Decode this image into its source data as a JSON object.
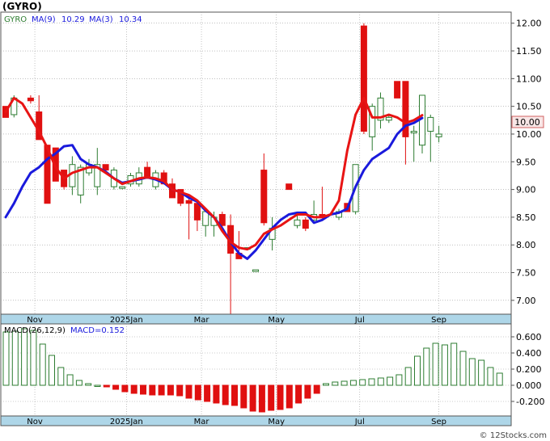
{
  "ticker": "(GYRO)",
  "legend": {
    "symbol": "GYRO",
    "ma9_label": "MA(9)",
    "ma9_value": "10.29",
    "ma3_label": "MA(3)",
    "ma3_value": "10.34"
  },
  "macd_legend": {
    "label": "MACD(26,12,9)",
    "value_label": "MACD=0.152"
  },
  "last_price_badge": "10.00",
  "watermark": "© 12Stocks.com",
  "colors": {
    "up_candle": "#2e7d32",
    "down_candle": "#e01010",
    "ma9": "#1a1adc",
    "ma3": "#e81414",
    "axis_band": "#aed6e8",
    "grid": "#9a9a9a"
  },
  "chart_data": [
    {
      "type": "candlestick",
      "title": "(GYRO)",
      "y_axis_ticks": [
        12.0,
        11.5,
        11.0,
        10.5,
        10.0,
        9.5,
        9.0,
        8.5,
        8.0,
        7.5,
        7.0
      ],
      "y_axis_labels": [
        "12.00",
        "11.50",
        "11.00",
        "10.50",
        "10.00",
        "9.50",
        "9.00",
        "8.50",
        "8.00",
        "7.50",
        "7.00"
      ],
      "ylim": [
        6.75,
        12.2
      ],
      "x_axis_labels": [
        "Nov",
        "2025Jan",
        "Mar",
        "May",
        "Jul",
        "Sep"
      ],
      "x_axis_label_weeks": [
        3.5,
        14.5,
        23.5,
        32.5,
        42.5,
        52
      ],
      "weeks": 58,
      "candles": [
        {
          "w": 0,
          "o": 10.5,
          "h": 10.5,
          "l": 10.3,
          "c": 10.3
        },
        {
          "w": 1,
          "o": 10.35,
          "h": 10.7,
          "l": 10.3,
          "c": 10.65
        },
        {
          "w": 3,
          "o": 10.65,
          "h": 10.7,
          "l": 10.55,
          "c": 10.6
        },
        {
          "w": 4,
          "o": 10.4,
          "h": 10.7,
          "l": 9.9,
          "c": 9.9
        },
        {
          "w": 5,
          "o": 9.8,
          "h": 9.8,
          "l": 8.75,
          "c": 8.75
        },
        {
          "w": 6,
          "o": 9.75,
          "h": 9.75,
          "l": 9.15,
          "c": 9.15
        },
        {
          "w": 7,
          "o": 9.35,
          "h": 9.35,
          "l": 9.0,
          "c": 9.05
        },
        {
          "w": 8,
          "o": 9.05,
          "h": 9.6,
          "l": 8.9,
          "c": 9.45
        },
        {
          "w": 9,
          "o": 8.9,
          "h": 9.45,
          "l": 8.75,
          "c": 9.4
        },
        {
          "w": 10,
          "o": 9.3,
          "h": 9.55,
          "l": 9.25,
          "c": 9.45
        },
        {
          "w": 11,
          "o": 9.05,
          "h": 9.75,
          "l": 8.9,
          "c": 9.45
        },
        {
          "w": 12,
          "o": 9.45,
          "h": 9.45,
          "l": 9.3,
          "c": 9.35
        },
        {
          "w": 13,
          "o": 9.05,
          "h": 9.4,
          "l": 9.0,
          "c": 9.35
        },
        {
          "w": 14,
          "o": 9.05,
          "h": 9.05,
          "l": 9.0,
          "c": 9.05
        },
        {
          "w": 15,
          "o": 9.1,
          "h": 9.3,
          "l": 9.05,
          "c": 9.25
        },
        {
          "w": 16,
          "o": 9.1,
          "h": 9.4,
          "l": 9.05,
          "c": 9.3
        },
        {
          "w": 17,
          "o": 9.4,
          "h": 9.5,
          "l": 9.2,
          "c": 9.2
        },
        {
          "w": 18,
          "o": 9.05,
          "h": 9.35,
          "l": 9.0,
          "c": 9.3
        },
        {
          "w": 19,
          "o": 9.3,
          "h": 9.35,
          "l": 9.1,
          "c": 9.1
        },
        {
          "w": 20,
          "o": 9.1,
          "h": 9.2,
          "l": 8.85,
          "c": 8.85
        },
        {
          "w": 21,
          "o": 9.0,
          "h": 9.0,
          "l": 8.7,
          "c": 8.75
        },
        {
          "w": 22,
          "o": 8.8,
          "h": 8.85,
          "l": 8.1,
          "c": 8.75
        },
        {
          "w": 23,
          "o": 8.75,
          "h": 8.75,
          "l": 8.25,
          "c": 8.45
        },
        {
          "w": 24,
          "o": 8.35,
          "h": 8.6,
          "l": 8.15,
          "c": 8.6
        },
        {
          "w": 25,
          "o": 8.35,
          "h": 8.6,
          "l": 8.15,
          "c": 8.5
        },
        {
          "w": 26,
          "o": 8.55,
          "h": 8.6,
          "l": 8.3,
          "c": 8.35
        },
        {
          "w": 27,
          "o": 8.35,
          "h": 8.55,
          "l": 6.75,
          "c": 7.85
        },
        {
          "w": 28,
          "o": 7.85,
          "h": 8.25,
          "l": 7.75,
          "c": 7.75
        },
        {
          "w": 29,
          "o": 7.95,
          "h": 7.95,
          "l": 7.95,
          "c": 7.95
        },
        {
          "w": 30,
          "o": 7.55,
          "h": 7.55,
          "l": 7.55,
          "c": 7.55
        },
        {
          "w": 31,
          "o": 9.35,
          "h": 9.65,
          "l": 8.35,
          "c": 8.4
        },
        {
          "w": 32,
          "o": 8.1,
          "h": 8.5,
          "l": 7.9,
          "c": 8.3
        },
        {
          "w": 34,
          "o": 9.1,
          "h": 9.1,
          "l": 9.0,
          "c": 9.0
        },
        {
          "w": 35,
          "o": 8.35,
          "h": 8.55,
          "l": 8.3,
          "c": 8.45
        },
        {
          "w": 36,
          "o": 8.45,
          "h": 8.5,
          "l": 8.25,
          "c": 8.3
        },
        {
          "w": 37,
          "o": 8.45,
          "h": 8.8,
          "l": 8.4,
          "c": 8.55
        },
        {
          "w": 38,
          "o": 8.55,
          "h": 9.05,
          "l": 8.5,
          "c": 8.5
        },
        {
          "w": 40,
          "o": 8.5,
          "h": 8.65,
          "l": 8.45,
          "c": 8.6
        },
        {
          "w": 41,
          "o": 8.75,
          "h": 8.75,
          "l": 8.6,
          "c": 8.6
        },
        {
          "w": 42,
          "o": 8.6,
          "h": 9.45,
          "l": 8.55,
          "c": 9.45
        },
        {
          "w": 43,
          "o": 11.95,
          "h": 12.0,
          "l": 10.0,
          "c": 10.05
        },
        {
          "w": 44,
          "o": 9.95,
          "h": 10.55,
          "l": 9.7,
          "c": 10.5
        },
        {
          "w": 45,
          "o": 10.25,
          "h": 10.75,
          "l": 10.1,
          "c": 10.65
        },
        {
          "w": 46,
          "o": 10.25,
          "h": 10.35,
          "l": 10.2,
          "c": 10.3
        },
        {
          "w": 47,
          "o": 10.95,
          "h": 10.95,
          "l": 10.65,
          "c": 10.65
        },
        {
          "w": 48,
          "o": 10.95,
          "h": 10.95,
          "l": 9.45,
          "c": 9.95
        },
        {
          "w": 49,
          "o": 10.05,
          "h": 10.15,
          "l": 9.5,
          "c": 10.05
        },
        {
          "w": 50,
          "o": 9.8,
          "h": 10.7,
          "l": 9.65,
          "c": 10.7
        },
        {
          "w": 51,
          "o": 10.05,
          "h": 10.35,
          "l": 9.5,
          "c": 10.3
        },
        {
          "w": 52,
          "o": 9.95,
          "h": 10.15,
          "l": 9.85,
          "c": 10.0
        }
      ],
      "series": [
        {
          "name": "MA(9)",
          "color": "#1a1adc",
          "points": [
            [
              0,
              8.5
            ],
            [
              1,
              8.75
            ],
            [
              2,
              9.05
            ],
            [
              3,
              9.3
            ],
            [
              4,
              9.4
            ],
            [
              5,
              9.55
            ],
            [
              6,
              9.65
            ],
            [
              7,
              9.78
            ],
            [
              8,
              9.8
            ],
            [
              9,
              9.55
            ],
            [
              10,
              9.45
            ],
            [
              11,
              9.4
            ],
            [
              12,
              9.32
            ],
            [
              13,
              9.2
            ],
            [
              14,
              9.12
            ],
            [
              15,
              9.15
            ],
            [
              16,
              9.18
            ],
            [
              17,
              9.22
            ],
            [
              18,
              9.18
            ],
            [
              19,
              9.12
            ],
            [
              20,
              9.0
            ],
            [
              21,
              8.95
            ],
            [
              22,
              8.85
            ],
            [
              23,
              8.78
            ],
            [
              24,
              8.62
            ],
            [
              25,
              8.5
            ],
            [
              26,
              8.3
            ],
            [
              27,
              8.05
            ],
            [
              28,
              7.85
            ],
            [
              29,
              7.75
            ],
            [
              30,
              7.9
            ],
            [
              31,
              8.1
            ],
            [
              32,
              8.3
            ],
            [
              33,
              8.45
            ],
            [
              34,
              8.55
            ],
            [
              35,
              8.58
            ],
            [
              36,
              8.58
            ],
            [
              37,
              8.4
            ],
            [
              38,
              8.45
            ],
            [
              39,
              8.55
            ],
            [
              40,
              8.58
            ],
            [
              41,
              8.65
            ],
            [
              42,
              9.05
            ],
            [
              43,
              9.35
            ],
            [
              44,
              9.55
            ],
            [
              45,
              9.65
            ],
            [
              46,
              9.75
            ],
            [
              47,
              10.0
            ],
            [
              48,
              10.15
            ],
            [
              49,
              10.2
            ],
            [
              50,
              10.29
            ]
          ]
        },
        {
          "name": "MA(3)",
          "color": "#e81414",
          "points": [
            [
              0,
              10.4
            ],
            [
              1,
              10.65
            ],
            [
              2,
              10.55
            ],
            [
              3,
              10.3
            ],
            [
              4,
              10.05
            ],
            [
              5,
              9.75
            ],
            [
              6,
              9.4
            ],
            [
              7,
              9.2
            ],
            [
              8,
              9.3
            ],
            [
              9,
              9.35
            ],
            [
              10,
              9.4
            ],
            [
              11,
              9.4
            ],
            [
              12,
              9.3
            ],
            [
              13,
              9.2
            ],
            [
              14,
              9.1
            ],
            [
              15,
              9.15
            ],
            [
              16,
              9.2
            ],
            [
              17,
              9.22
            ],
            [
              18,
              9.2
            ],
            [
              19,
              9.15
            ],
            [
              20,
              9.0
            ],
            [
              21,
              8.95
            ],
            [
              22,
              8.9
            ],
            [
              23,
              8.8
            ],
            [
              24,
              8.65
            ],
            [
              25,
              8.5
            ],
            [
              26,
              8.25
            ],
            [
              27,
              8.05
            ],
            [
              28,
              7.95
            ],
            [
              29,
              7.92
            ],
            [
              30,
              8.0
            ],
            [
              31,
              8.2
            ],
            [
              32,
              8.28
            ],
            [
              33,
              8.35
            ],
            [
              34,
              8.45
            ],
            [
              35,
              8.55
            ],
            [
              36,
              8.55
            ],
            [
              37,
              8.5
            ],
            [
              38,
              8.5
            ],
            [
              39,
              8.55
            ],
            [
              40,
              8.8
            ],
            [
              41,
              9.7
            ],
            [
              42,
              10.35
            ],
            [
              43,
              10.65
            ],
            [
              44,
              10.3
            ],
            [
              45,
              10.3
            ],
            [
              46,
              10.35
            ],
            [
              47,
              10.3
            ],
            [
              48,
              10.2
            ],
            [
              49,
              10.25
            ],
            [
              50,
              10.34
            ]
          ]
        }
      ]
    },
    {
      "type": "bar",
      "title": "MACD(26,12,9)",
      "y_axis_ticks": [
        0.6,
        0.4,
        0.2,
        0.0,
        -0.2
      ],
      "y_axis_labels": [
        "0.600",
        "0.400",
        "0.200",
        "0.000",
        "-0.200"
      ],
      "ylim": [
        -0.38,
        0.76
      ],
      "x_axis_labels": [
        "Nov",
        "2025Jan",
        "Mar",
        "May",
        "Jul",
        "Sep"
      ],
      "x_axis_label_weeks": [
        3.5,
        14.5,
        23.5,
        32.5,
        42.5,
        52
      ],
      "values": [
        0.66,
        0.67,
        0.7,
        0.68,
        0.51,
        0.37,
        0.22,
        0.13,
        0.06,
        0.02,
        0.0,
        -0.02,
        -0.05,
        -0.08,
        -0.1,
        -0.11,
        -0.12,
        -0.12,
        -0.12,
        -0.13,
        -0.16,
        -0.18,
        -0.2,
        -0.22,
        -0.24,
        -0.25,
        -0.28,
        -0.32,
        -0.33,
        -0.31,
        -0.3,
        -0.28,
        -0.22,
        -0.16,
        -0.1,
        0.02,
        0.04,
        0.05,
        0.06,
        0.07,
        0.08,
        0.09,
        0.1,
        0.13,
        0.22,
        0.36,
        0.46,
        0.52,
        0.5,
        0.52,
        0.42,
        0.33,
        0.31,
        0.22,
        0.15
      ]
    }
  ]
}
